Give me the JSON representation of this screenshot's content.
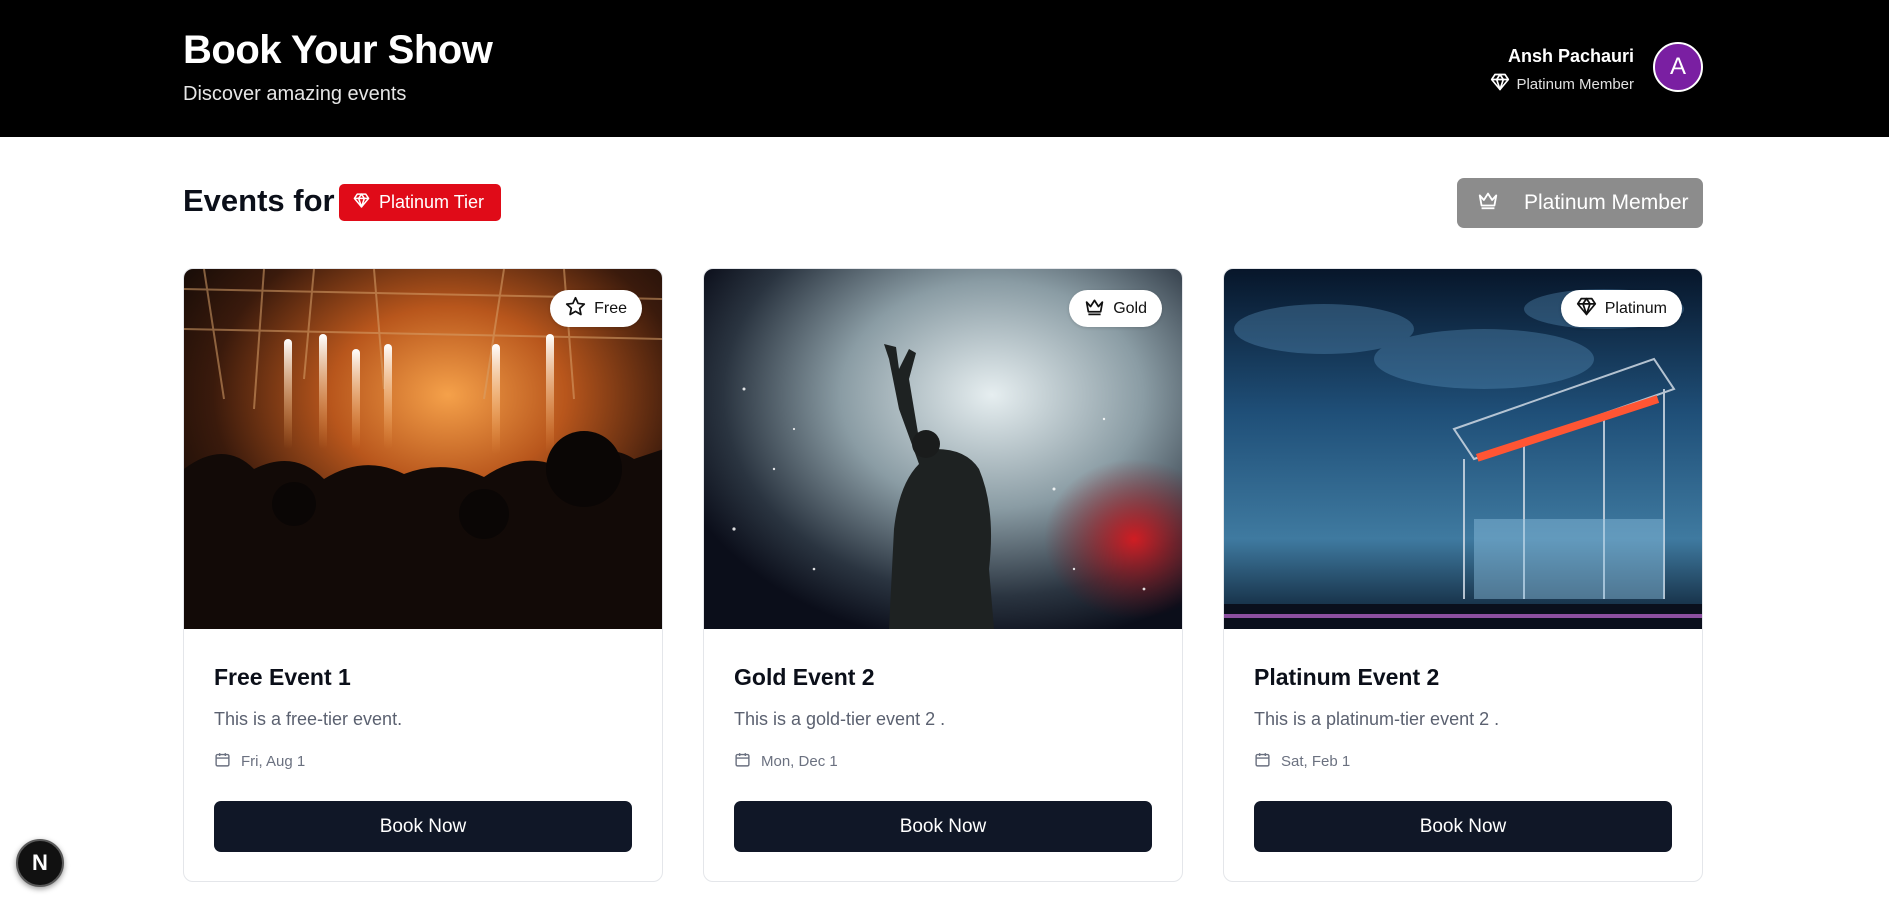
{
  "header": {
    "title": "Book Your Show",
    "subtitle": "Discover amazing events",
    "user": {
      "name": "Ansh Pachauri",
      "tier": "Platinum Member",
      "tier_icon": "diamond-icon",
      "avatar_initial": "A",
      "avatar_color": "#7a1fa2"
    }
  },
  "section": {
    "title": "Events for",
    "tier_badge": "Platinum Tier",
    "tier_badge_icon": "diamond-icon",
    "tier_badge_color": "#e00b18",
    "member_button": "Platinum Member",
    "member_button_icon": "crown-icon"
  },
  "events": [
    {
      "tier": "Free",
      "tier_icon": "star-icon",
      "title": "Free Event 1",
      "description": "This is a free-tier event.",
      "date": "Fri, Aug 1",
      "button": "Book Now",
      "image": "concert-crowd-with-flames"
    },
    {
      "tier": "Gold",
      "tier_icon": "crown-icon",
      "title": "Gold Event 2",
      "description": "This is a gold-tier event 2 .",
      "date": "Mon, Dec 1",
      "button": "Book Now",
      "image": "performer-raising-hand-in-smoke"
    },
    {
      "tier": "Platinum",
      "tier_icon": "diamond-icon",
      "title": "Platinum Event 2",
      "description": "This is a platinum-tier event 2 .",
      "date": "Sat, Feb 1",
      "button": "Book Now",
      "image": "festival-stage-blue-smoke"
    }
  ],
  "dev_badge": {
    "label": "N"
  },
  "colors": {
    "header_bg": "#000000",
    "button_bg": "#101727",
    "member_button_bg": "#8c8c8c"
  }
}
